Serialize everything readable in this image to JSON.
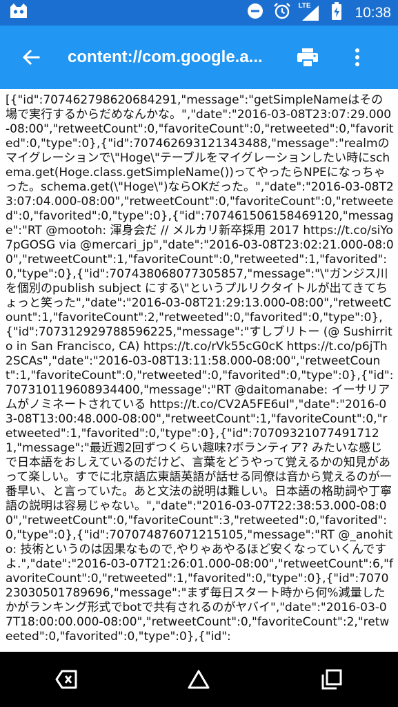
{
  "status_bar": {
    "time": "10:38",
    "network_label": "LTE",
    "icons": [
      "cat-notification-icon",
      "do-not-disturb-icon",
      "alarm-icon",
      "cellular-signal-icon",
      "battery-charging-icon"
    ]
  },
  "app_bar": {
    "title": "content://com.google.a...",
    "icons": [
      "back-arrow-icon",
      "print-icon",
      "more-vert-icon"
    ],
    "color": "#2196f3",
    "status_color": "#1a6fd0"
  },
  "content": {
    "text": "[{\"id\":707462798620684291,\"message\":\"getSimpleNameはその場で実行するからだめなんかな。\",\"date\":\"2016-03-08T23:07:29.000-08:00\",\"retweetCount\":0,\"favoriteCount\":0,\"retweeted\":0,\"favorited\":0,\"type\":0},{\"id\":707462693121343488,\"message\":\"realmのマイグレーションで\\\"Hoge\\\"テーブルをマイグレーションしたい時にschema.get(Hoge.class.getSimpleName())ってやったらNPEになっちゃった。schema.get(\\\"Hoge\\\")ならOKだった。\",\"date\":\"2016-03-08T23:07:04.000-08:00\",\"retweetCount\":0,\"favoriteCount\":0,\"retweeted\":0,\"favorited\":0,\"type\":0},{\"id\":707461506158469120,\"message\":\"RT @mootoh: 渾身会だ // メルカリ新卒採用 2017 https://t.co/siYo7pGOSG via @mercari_jp\",\"date\":\"2016-03-08T23:02:21.000-08:00\",\"retweetCount\":1,\"favoriteCount\":0,\"retweeted\":1,\"favorited\":0,\"type\":0},{\"id\":707438068077305857,\"message\":\"\\\"ガンジス川を個別のpublish subject にする\\\"というプルリクタイトルが出てきてちょっと笑った\",\"date\":\"2016-03-08T21:29:13.000-08:00\",\"retweetCount\":1,\"favoriteCount\":2,\"retweeted\":0,\"favorited\":0,\"type\":0},{\"id\":707312929788596225,\"message\":\"すしブリトー (@ Sushirrito in San Francisco, CA) https://t.co/rVk55cG0cK https://t.co/p6jTh2SCAs\",\"date\":\"2016-03-08T13:11:58.000-08:00\",\"retweetCount\":1,\"favoriteCount\":0,\"retweeted\":0,\"favorited\":0,\"type\":0},{\"id\":707310119608934400,\"message\":\"RT @daitomanabe: イーサリアムがノミネートされている https://t.co/CV2A5FE6uI\",\"date\":\"2016-03-08T13:00:48.000-08:00\",\"retweetCount\":1,\"favoriteCount\":0,\"retweeted\":1,\"favorited\":0,\"type\":0},{\"id\":707093210774917121,\"message\":\"最近週2回ずつくらい趣味?ボランティア? みたいな感じで日本語をおしえているのだけど、言葉をどうやって覚えるかの知見があって楽しい。すでに北京語広東語英語が話せる同僚は音から覚えるのが一番早い、と言っていた。あと文法の説明は難しい。日本語の格助詞や丁寧語の説明は容易じゃない。\",\"date\":\"2016-03-07T22:38:53.000-08:00\",\"retweetCount\":0,\"favoriteCount\":3,\"retweeted\":0,\"favorited\":0,\"type\":0},{\"id\":707074876071215105,\"message\":\"RT @_anohito: 技術というのは因果なもので,やりゃあやるほど安くなっていくんですよ.\",\"date\":\"2016-03-07T21:26:01.000-08:00\",\"retweetCount\":6,\"favoriteCount\":0,\"retweeted\":1,\"favorited\":0,\"type\":0},{\"id\":707023030501789696,\"message\":\"まず毎日スタート時から何%減量したかがランキング形式でbotで共有されるのがヤバイ\",\"date\":\"2016-03-07T18:00:00.000-08:00\",\"retweetCount\":0,\"favoriteCount\":2,\"retweeted\":0,\"favorited\":0,\"type\":0},{\"id\":"
  },
  "nav_bar": {
    "icons": [
      "back-nav-icon",
      "home-nav-icon",
      "recents-nav-icon"
    ]
  }
}
